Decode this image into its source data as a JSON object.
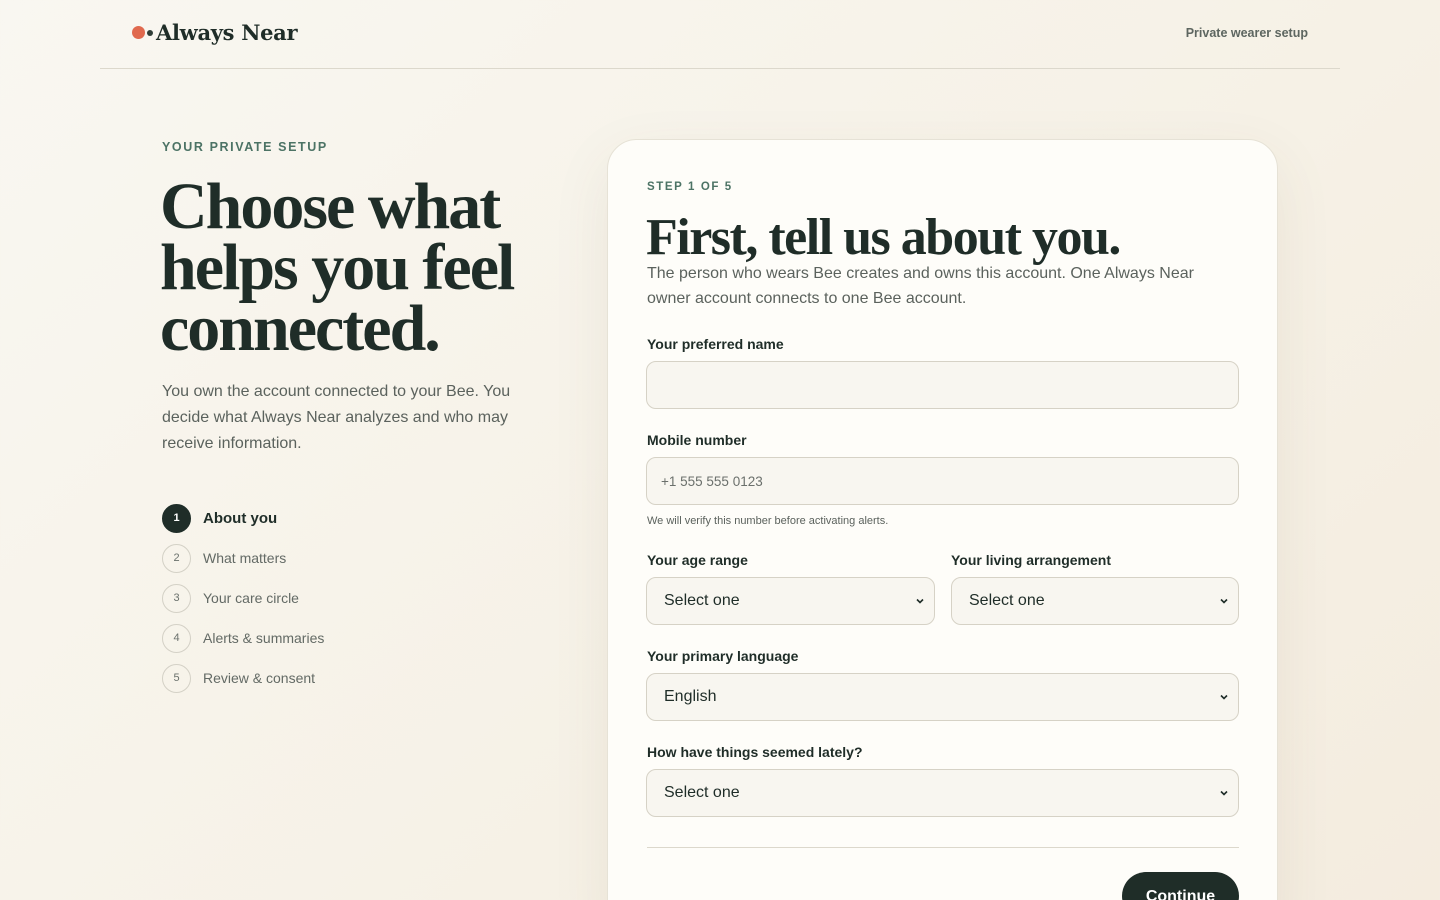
{
  "header": {
    "brand": "Always Near",
    "right_link": "Private wearer setup"
  },
  "intro": {
    "eyebrow": "YOUR PRIVATE SETUP",
    "headline": "Choose what helps you feel connected.",
    "lead": "You own the account connected to your Bee. You decide what Always Near analyzes and who may receive information."
  },
  "steps": [
    {
      "num": "1",
      "label": "About you",
      "active": true
    },
    {
      "num": "2",
      "label": "What matters",
      "active": false
    },
    {
      "num": "3",
      "label": "Your care circle",
      "active": false
    },
    {
      "num": "4",
      "label": "Alerts & summaries",
      "active": false
    },
    {
      "num": "5",
      "label": "Review & consent",
      "active": false
    }
  ],
  "form": {
    "step_indicator": "STEP 1 OF 5",
    "title": "First, tell us about you.",
    "description": "The person who wears Bee creates and owns this account. One Always Near owner account connects to one Bee account.",
    "name_label": "Your preferred name",
    "name_value": "",
    "phone_label": "Mobile number",
    "phone_placeholder": "+1 555 555 0123",
    "phone_helper": "We will verify this number before activating alerts.",
    "age_label": "Your age range",
    "age_value": "Select one",
    "living_label": "Your living arrangement",
    "living_value": "Select one",
    "language_label": "Your primary language",
    "language_value": "English",
    "lately_label": "How have things seemed lately?",
    "lately_value": "Select one",
    "continue_label": "Continue"
  },
  "icons": {
    "select_chevron": "chevron-down-icon",
    "logo_mark": "logo-dots-icon"
  },
  "colors": {
    "accent_dark": "#1f2d28",
    "accent_green": "#4c7365",
    "logo_coral": "#e0694e",
    "background": "#f6f1e6"
  }
}
